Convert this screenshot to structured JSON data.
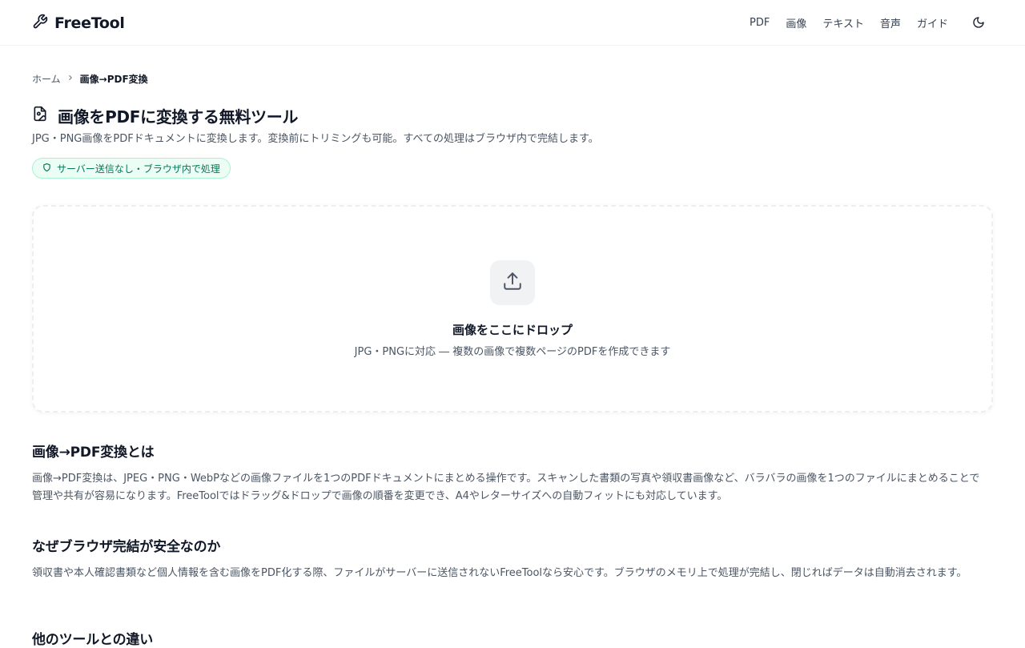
{
  "header": {
    "brand": "FreeTool",
    "nav": [
      "PDF",
      "画像",
      "テキスト",
      "音声",
      "ガイド"
    ]
  },
  "breadcrumb": {
    "home": "ホーム",
    "current": "画像→PDF変換"
  },
  "page": {
    "title": "画像をPDFに変換する無料ツール",
    "subtitle": "JPG・PNG画像をPDFドキュメントに変換します。変換前にトリミングも可能。すべての処理はブラウザ内で完結します。",
    "badge": "サーバー送信なし・ブラウザ内で処理"
  },
  "dropzone": {
    "title": "画像をここにドロップ",
    "hint": "JPG・PNGに対応 ― 複数の画像で複数ページのPDFを作成できます"
  },
  "sections": [
    {
      "heading": "画像→PDF変換とは",
      "body": "画像→PDF変換は、JPEG・PNG・WebPなどの画像ファイルを1つのPDFドキュメントにまとめる操作です。スキャンした書類の写真や領収書画像など、バラバラの画像を1つのファイルにまとめることで管理や共有が容易になります。FreeToolではドラッグ&ドロップで画像の順番を変更でき、A4やレターサイズへの自動フィットにも対応しています。"
    },
    {
      "heading": "なぜブラウザ完結が安全なのか",
      "body": "領収書や本人確認書類など個人情報を含む画像をPDF化する際、ファイルがサーバーに送信されないFreeToolなら安心です。ブラウザのメモリ上で処理が完結し、閉じればデータは自動消去されます。"
    },
    {
      "heading": "他のツールとの違い"
    }
  ],
  "colors": {
    "accent_green": "#047857",
    "badge_bg": "#ecfdf5",
    "text_primary": "#111827",
    "text_secondary": "#4b5563"
  },
  "icons": {
    "brand": "wrench-icon",
    "theme": "moon-icon",
    "breadcrumb_sep": "chevron-right-icon",
    "title": "file-image-icon",
    "badge": "shield-icon",
    "upload": "upload-icon"
  }
}
